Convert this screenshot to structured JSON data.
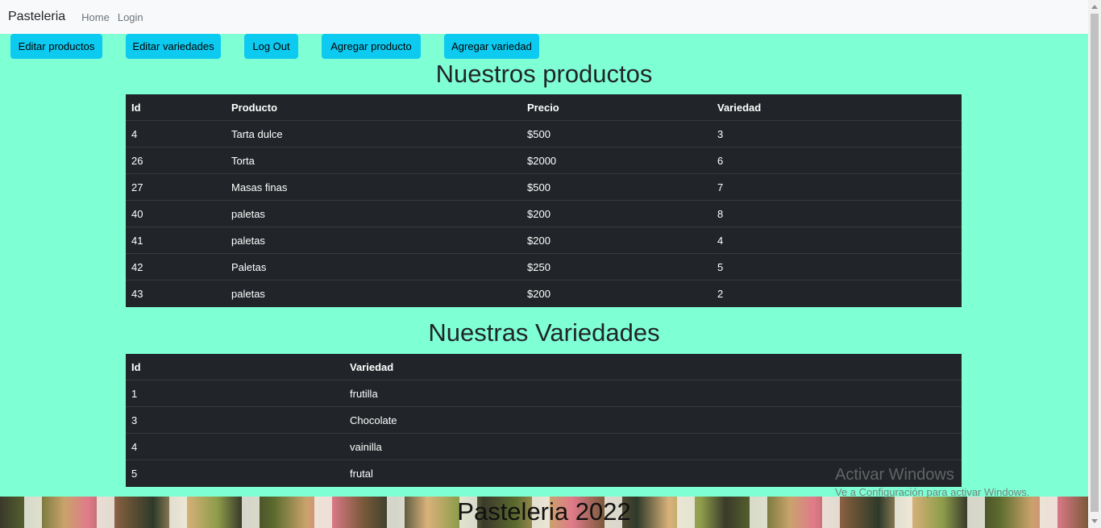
{
  "navbar": {
    "brand": "Pasteleria",
    "links": [
      "Home",
      "Login"
    ]
  },
  "actions": [
    "Editar productos",
    "Editar variedades",
    "Log Out",
    "Agregar producto",
    "Agregar variedad"
  ],
  "productos": {
    "title": "Nuestros productos",
    "columns": [
      "Id",
      "Producto",
      "Precio",
      "Variedad"
    ],
    "rows": [
      [
        "4",
        "Tarta dulce",
        "$500",
        "3"
      ],
      [
        "26",
        "Torta",
        "$2000",
        "6"
      ],
      [
        "27",
        "Masas finas",
        "$500",
        "7"
      ],
      [
        "40",
        "paletas",
        "$200",
        "8"
      ],
      [
        "41",
        "paletas",
        "$200",
        "4"
      ],
      [
        "42",
        "Paletas",
        "$250",
        "5"
      ],
      [
        "43",
        "paletas",
        "$200",
        "2"
      ]
    ]
  },
  "variedades": {
    "title": "Nuestras Variedades",
    "columns": [
      "Id",
      "Variedad"
    ],
    "rows": [
      [
        "1",
        "frutilla"
      ],
      [
        "3",
        "Chocolate"
      ],
      [
        "4",
        "vainilla"
      ],
      [
        "5",
        "frutal"
      ]
    ]
  },
  "footer": {
    "title": "Pasteleria 2022"
  },
  "watermark": {
    "line1": "Activar Windows",
    "line2": "Ve a Configuración para activar Windows."
  },
  "colors": {
    "background": "#7fffd4",
    "button": "#0dcaf0",
    "table": "#212529"
  }
}
